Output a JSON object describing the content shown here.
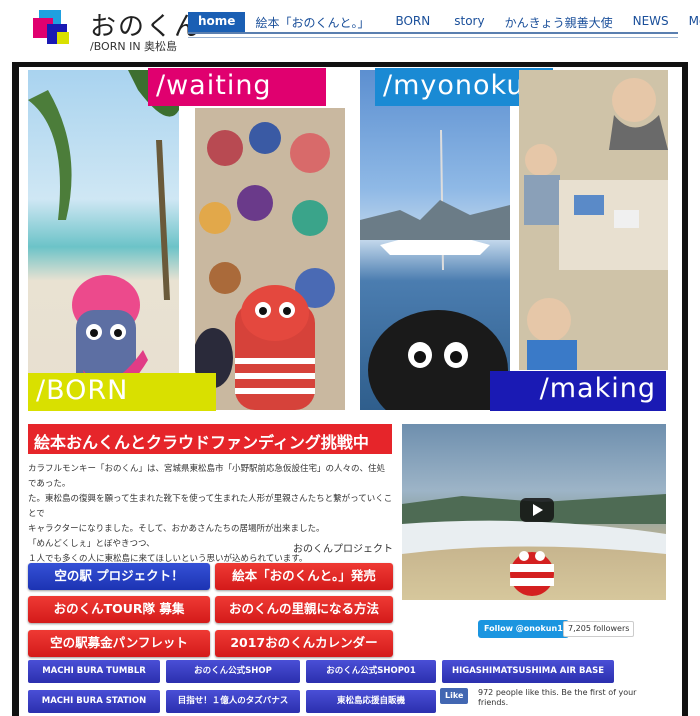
{
  "header": {
    "site_title": "おのくん",
    "site_subtitle": "/BORN IN 奥松島",
    "nav": [
      "home",
      "絵本「おのくんと。」",
      "BORN",
      "story",
      "かんきょう親善大使",
      "NEWS",
      "More"
    ],
    "colors": {
      "nav_active": "#1a5fb4",
      "nav_text": "#1a4f9a"
    }
  },
  "collage": {
    "tags": {
      "waiting": "/waiting",
      "myonokun": "/myonokun",
      "born": "/BORN",
      "making": "/making"
    },
    "colors": {
      "waiting": "#e0006f",
      "myonokun": "#1a8ad4",
      "born": "#d9e000",
      "making": "#1a1ab4"
    }
  },
  "crowdfunding": {
    "title": "絵本おんくんとクラウドファンディング挑戦中",
    "body_lines": [
      "カラフルモンキー「おのくん」は、宮城県東松島市「小野駅前応急仮設住宅」の人々の、住処であった。",
      "た。東松島の復興を願って生まれた靴下を使って生まれた人形が里親さんたちと繋がっていくことで",
      "キャラクターになりました。そして、おかあさんたちの居場所が出来ました。",
      "「めんどくしぇ」とぼやきつつ、",
      "１人でも多くの人に東松島に来てほしいという思いが込められています。"
    ],
    "signature": "おのくんプロジェクト"
  },
  "buttons": {
    "michinoeki": "空の駅 プロジェクト！",
    "ehon": "絵本「おのくんと。」発売",
    "tour": "おのくんTOUR隊 募集",
    "satooya": "おのくんの里親になる方法",
    "pamphlet": "空の駅募金パンフレット",
    "calendar": "2017おのくんカレンダー"
  },
  "links": {
    "tumblr": "MACHI BURA TUMBLR",
    "shop": "おのくん公式SHOP",
    "shop01": "おのくん公式SHOP01",
    "airbase": "HIGASHIMATSUSHIMA AIR BASE",
    "station": "MACHI BURA STATION",
    "banana": "目指せ！１億人のタズバナス",
    "hanbaiki": "東松島応援自販機"
  },
  "social": {
    "twitter_label": "Follow @onokun1",
    "twitter_followers": "7,205 followers",
    "fb_label": "Like",
    "fb_text": "972 people like this. Be the first of your friends."
  }
}
